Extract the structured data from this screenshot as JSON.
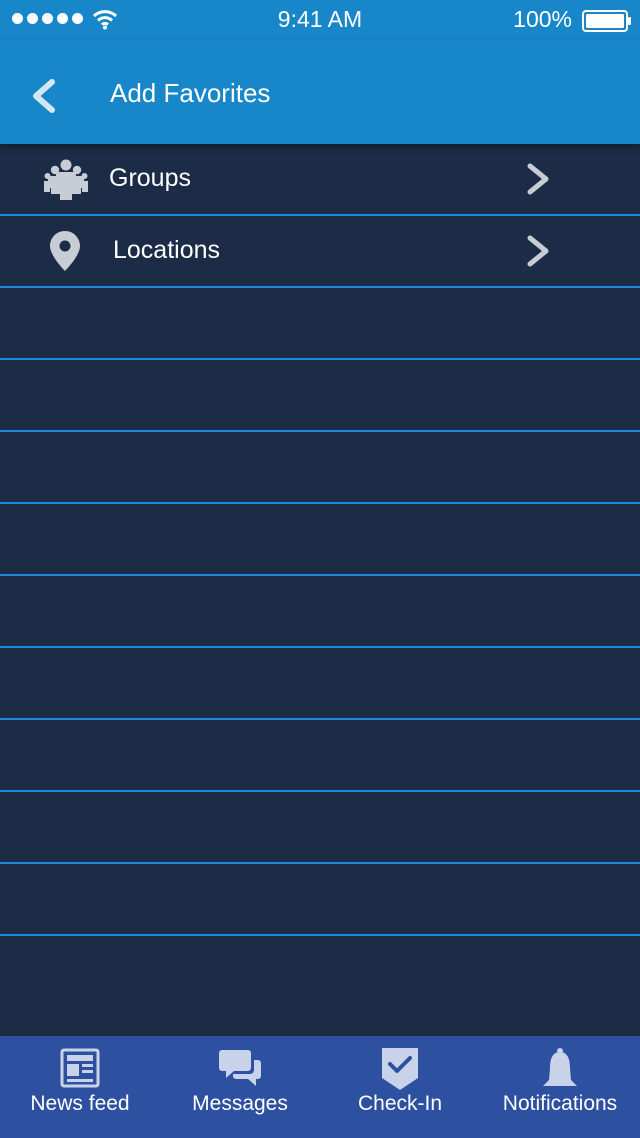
{
  "status_bar": {
    "time": "9:41 AM",
    "battery": "100%",
    "signal_icon": "signal-dots-icon",
    "wifi_icon": "wifi-icon",
    "battery_icon": "battery-icon"
  },
  "header": {
    "title": "Add Favorites",
    "back_icon": "chevron-left-icon"
  },
  "list": {
    "items": [
      {
        "label": "Groups",
        "icon": "group-icon"
      },
      {
        "label": "Locations",
        "icon": "location-pin-icon"
      }
    ]
  },
  "tabbar": {
    "tabs": [
      {
        "label": "News feed",
        "icon": "newspaper-icon"
      },
      {
        "label": "Messages",
        "icon": "chat-bubbles-icon"
      },
      {
        "label": "Check-In",
        "icon": "check-shield-icon"
      },
      {
        "label": "Notifications",
        "icon": "bell-icon"
      }
    ]
  },
  "colors": {
    "header_bg": "#1787c9",
    "body_bg": "#1c2c47",
    "divider": "#1d8ad6",
    "tabbar_bg": "#2d50a0",
    "icon_gray": "#c8ccd4"
  }
}
